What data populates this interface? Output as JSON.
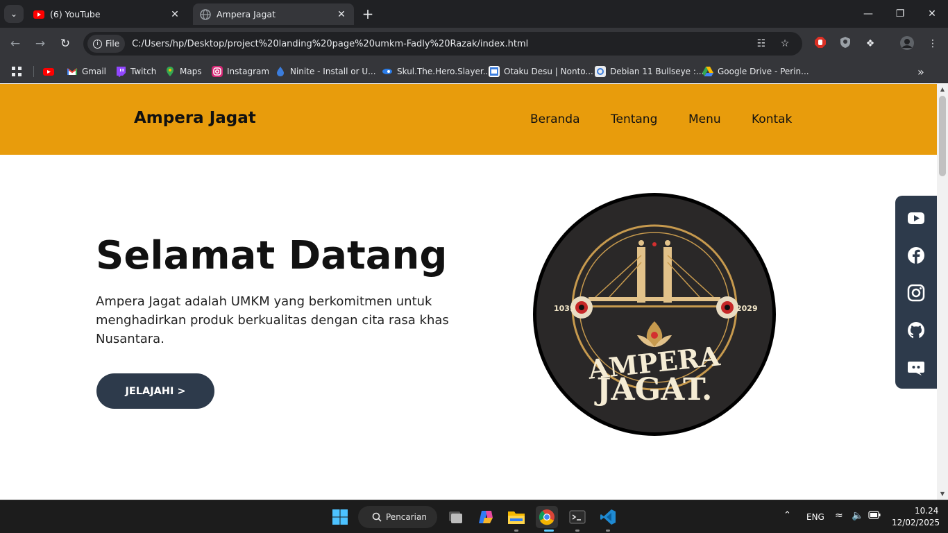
{
  "browser": {
    "tabs": [
      {
        "title": "(6) YouTube",
        "active": false
      },
      {
        "title": "Ampera Jagat",
        "active": true
      }
    ],
    "address_chip": "File",
    "url": "C:/Users/hp/Desktop/project%20landing%20page%20umkm-Fadly%20Razak/index.html",
    "bookmarks": [
      {
        "label": "",
        "icon": "youtube-icon"
      },
      {
        "label": "Gmail",
        "icon": "gmail-icon"
      },
      {
        "label": "Twitch",
        "icon": "twitch-icon"
      },
      {
        "label": "Maps",
        "icon": "maps-icon"
      },
      {
        "label": "Instagram",
        "icon": "instagram-icon"
      },
      {
        "label": "Ninite - Install or U...",
        "icon": "ninite-icon"
      },
      {
        "label": "Skul.The.Hero.Slayer...",
        "icon": "skul-icon"
      },
      {
        "label": "Otaku Desu | Nonto...",
        "icon": "otakudesu-icon"
      },
      {
        "label": "Debian 11 Bullseye :...",
        "icon": "debian-icon"
      },
      {
        "label": "Google Drive - Perin...",
        "icon": "google-drive-icon"
      }
    ]
  },
  "site": {
    "brand": "Ampera Jagat",
    "nav": [
      "Beranda",
      "Tentang",
      "Menu",
      "Kontak"
    ],
    "hero": {
      "title": "Selamat Datang",
      "description": "Ampera Jagat adalah UMKM yang berkomitmen untuk menghadirkan produk berkualitas dengan cita rasa khas Nusantara.",
      "cta": "JELAJAHI >"
    },
    "logo": {
      "line1": "AMPERA",
      "line2": "JAGAT.",
      "year_left": "1039",
      "year_right": "2029"
    },
    "social": [
      "youtube-icon",
      "facebook-icon",
      "instagram-icon",
      "github-icon",
      "discord-icon"
    ]
  },
  "taskbar": {
    "search_label": "Pencarian",
    "language": "ENG",
    "time": "10.24",
    "date": "12/02/2025"
  },
  "colors": {
    "header": "#e89c0c",
    "navy": "#2d3a4b",
    "chrome_dark": "#202124",
    "chrome_mid": "#35363a"
  }
}
